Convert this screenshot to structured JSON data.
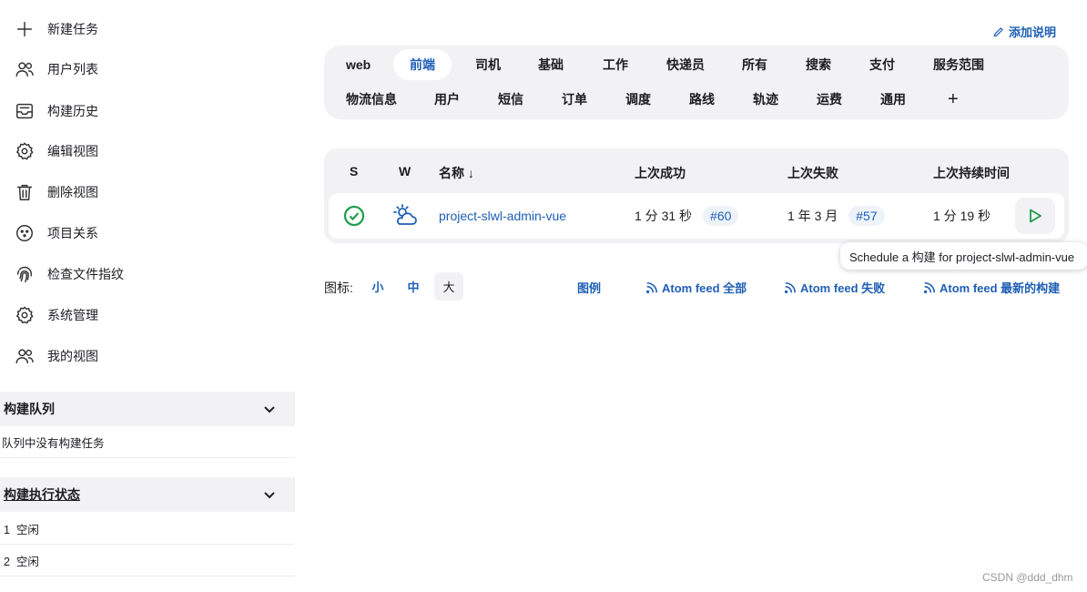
{
  "sidebar": {
    "items": [
      {
        "label": "新建任务",
        "icon": "plus-icon"
      },
      {
        "label": "用户列表",
        "icon": "users-icon"
      },
      {
        "label": "构建历史",
        "icon": "inbox-icon"
      },
      {
        "label": "编辑视图",
        "icon": "gear-icon"
      },
      {
        "label": "删除视图",
        "icon": "trash-icon"
      },
      {
        "label": "项目关系",
        "icon": "relation-icon"
      },
      {
        "label": "检查文件指纹",
        "icon": "fingerprint-icon"
      },
      {
        "label": "系统管理",
        "icon": "gear-icon"
      },
      {
        "label": "我的视图",
        "icon": "users-icon"
      }
    ],
    "build_queue": {
      "title": "构建队列",
      "empty_text": "队列中没有构建任务"
    },
    "executor_status": {
      "title": "构建执行状态",
      "rows": [
        "1  空闲",
        "2  空闲"
      ]
    }
  },
  "header": {
    "add_description": "添加说明"
  },
  "tabs": {
    "row1": [
      "web",
      "前端",
      "司机",
      "基础",
      "工作",
      "快递员",
      "所有",
      "搜索",
      "支付",
      "服务范围"
    ],
    "row2": [
      "物流信息",
      "用户",
      "短信",
      "订单",
      "调度",
      "路线",
      "轨迹",
      "运费",
      "通用"
    ],
    "active": "前端",
    "add_symbol": "+"
  },
  "table": {
    "headers": {
      "s": "S",
      "w": "W",
      "name": "名称 ↓",
      "last_success": "上次成功",
      "last_failure": "上次失败",
      "last_duration": "上次持续时间"
    },
    "rows": [
      {
        "status": "success",
        "weather": "partly-cloudy",
        "name": "project-slwl-admin-vue",
        "last_success": "1 分 31 秒",
        "last_success_build": "#60",
        "last_failure": "1 年 3 月",
        "last_failure_build": "#57",
        "last_duration": "1 分 19 秒"
      }
    ]
  },
  "tooltip": "Schedule a 构建 for project-slwl-admin-vue",
  "footer": {
    "icon_label": "图标:",
    "sizes": [
      "小",
      "中",
      "大"
    ],
    "active_size": "大",
    "legend": "图例",
    "atom_all": "Atom feed 全部",
    "atom_failed": "Atom feed 失败",
    "atom_latest": "Atom feed 最新的构建"
  },
  "watermark": "CSDN @ddd_dhm",
  "colors": {
    "accent": "#1f5fb5",
    "success": "#1e9e4a",
    "panel": "#f2f2f5"
  }
}
